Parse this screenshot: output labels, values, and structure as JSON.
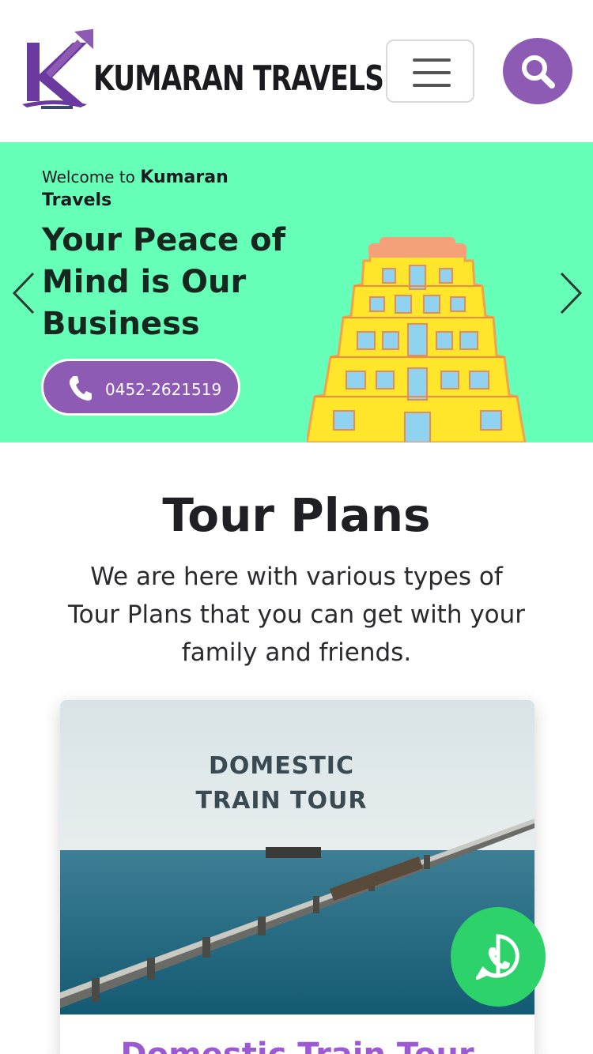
{
  "brand": {
    "name": "KUMARAN TRAVELS"
  },
  "header": {
    "menu_icon": "hamburger-icon",
    "search_icon": "search-icon"
  },
  "hero": {
    "welcome_prefix": "Welcome to",
    "welcome_brand": "Kumaran Travels",
    "headline": "Your Peace of Mind is Our Business",
    "phone": "0452-2621519",
    "prev_icon": "chevron-left-icon",
    "next_icon": "chevron-right-icon",
    "background_color": "#66ffb8"
  },
  "tour_plans": {
    "title": "Tour Plans",
    "subtitle": "We are here with various types of Tour Plans that you can get with your family and friends.",
    "cards": [
      {
        "image_text_line1": "DOMESTIC",
        "image_text_line2": "TRAIN TOUR",
        "title": "Domestic Train Tour"
      }
    ]
  },
  "floating": {
    "whatsapp_icon": "whatsapp-icon"
  },
  "colors": {
    "accent": "#8e5bb4",
    "card_title": "#9b59d3",
    "whatsapp": "#2dd36a"
  }
}
